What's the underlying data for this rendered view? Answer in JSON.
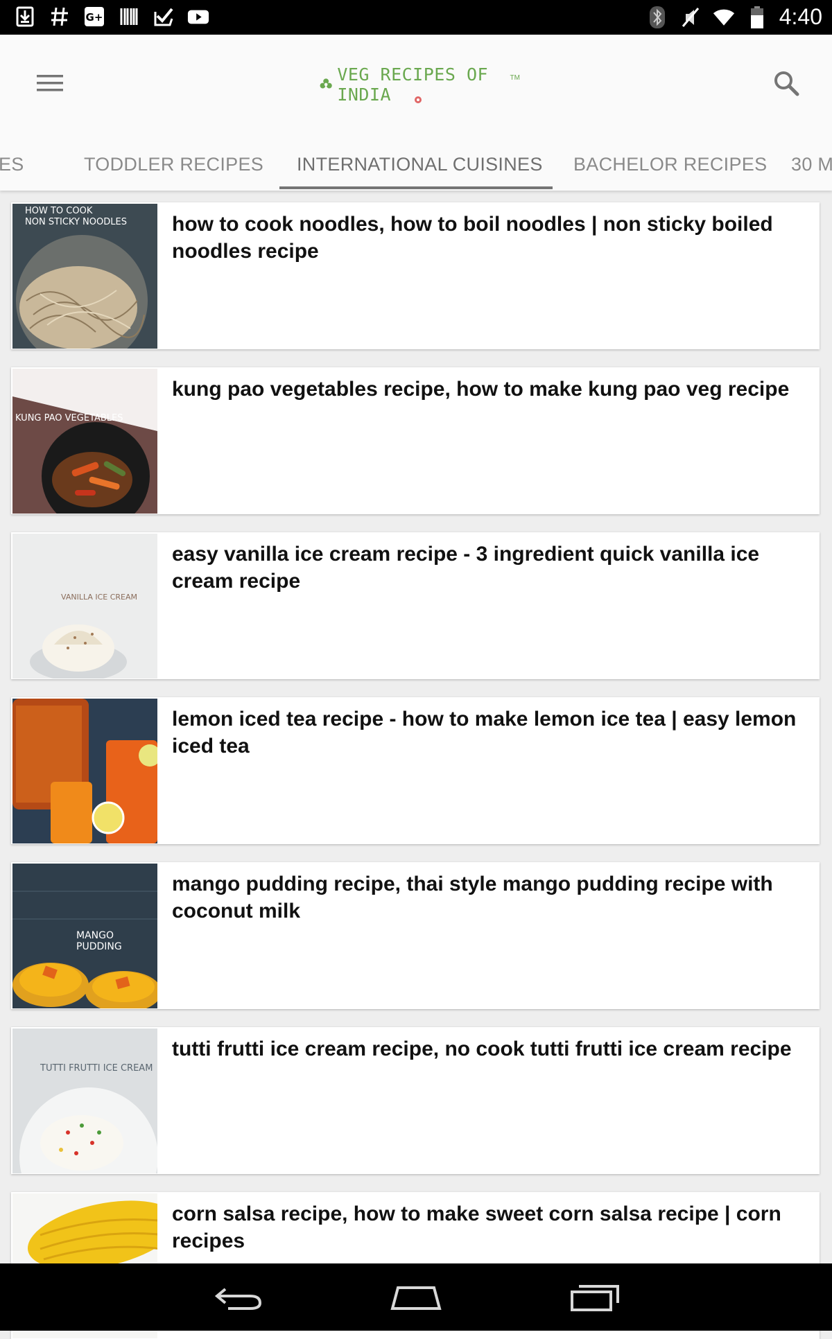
{
  "status_bar": {
    "time": "4:40",
    "left_icons": [
      "download-icon",
      "hashtag-icon",
      "google-plus-icon",
      "barcode-icon",
      "inbox-check-icon",
      "youtube-icon"
    ],
    "right_icons": [
      "bluetooth-icon",
      "mute-icon",
      "wifi-icon",
      "battery-icon"
    ]
  },
  "app_bar": {
    "logo_text": "VEG RECIPES OF INDIA",
    "logo_tm": "TM"
  },
  "tabs": [
    {
      "label": "ES",
      "active": false
    },
    {
      "label": "TODDLER RECIPES",
      "active": false
    },
    {
      "label": "INTERNATIONAL CUISINES",
      "active": true
    },
    {
      "label": "BACHELOR RECIPES",
      "active": false
    },
    {
      "label": "30 M",
      "active": false
    }
  ],
  "recipes": [
    {
      "title": "how to cook noodles, how to boil noodles | non sticky boiled noodles recipe",
      "image_text": "HOW TO COOK\nNON STICKY NOODLES"
    },
    {
      "title": "kung pao vegetables recipe, how to make kung pao veg recipe",
      "image_text": "KUNG PAO VEGETABLES"
    },
    {
      "title": "easy vanilla ice cream recipe - 3 ingredient quick vanilla ice cream recipe",
      "image_text": "VANILLA ICE CREAM"
    },
    {
      "title": "lemon iced tea recipe - how to make lemon ice tea | easy lemon iced tea",
      "image_text": ""
    },
    {
      "title": "mango pudding recipe, thai style mango pudding recipe with coconut milk",
      "image_text": "MANGO PUDDING"
    },
    {
      "title": "tutti frutti ice cream recipe, no cook tutti frutti ice cream recipe",
      "image_text": "TUTTI FRUTTI ICE CREAM"
    },
    {
      "title": "corn salsa recipe, how to make sweet corn salsa recipe | corn recipes",
      "image_text": ""
    }
  ],
  "colors": {
    "brand_green": "#6aa84f",
    "tab_indicator": "#757575"
  },
  "nav_bar": {
    "buttons": [
      "back-icon",
      "home-icon",
      "recent-apps-icon"
    ]
  }
}
